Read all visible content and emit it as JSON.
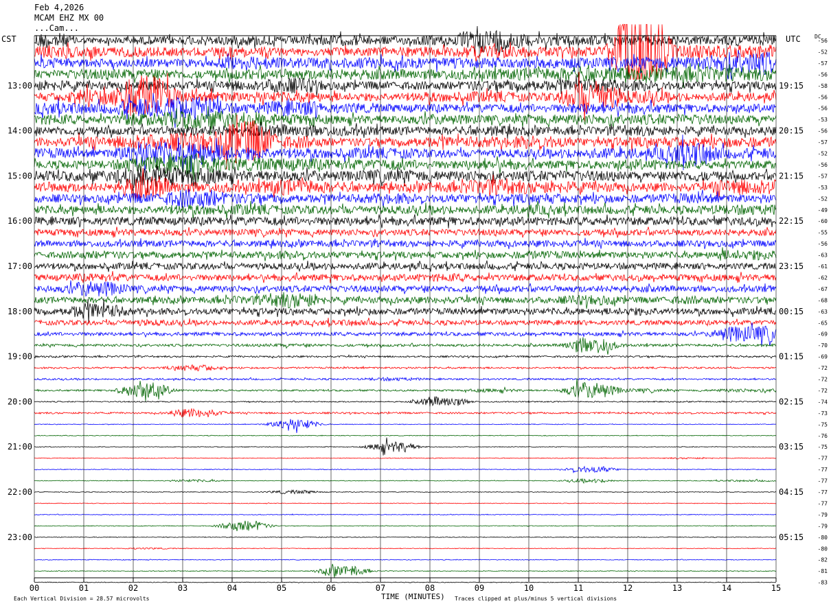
{
  "header": {
    "date": "Feb 4,2026",
    "station": "MCAM EHZ MX 00",
    "network_line": "...Cam..."
  },
  "labels": {
    "left_timezone": "CST",
    "right_timezone": "UTC",
    "dc_label": "DC"
  },
  "footer": {
    "scale_text": "Each Vertical Division =   28.57 microvolts",
    "xlabel": "TIME (MINUTES)",
    "clip_text": "Traces clipped at plus/minus 5 vertical divisions"
  },
  "colors": {
    "trace_cycle": [
      "#000000",
      "#ff0000",
      "#0000ff",
      "#006400"
    ],
    "grid": "#000000",
    "background": "#ffffff"
  },
  "chart_data": {
    "type": "line",
    "description_of_plot": "helicorder",
    "xlim": [
      0,
      15
    ],
    "x_ticks": [
      "00",
      "01",
      "02",
      "03",
      "04",
      "05",
      "06",
      "07",
      "08",
      "09",
      "10",
      "11",
      "12",
      "13",
      "14",
      "15"
    ],
    "left_time_labels": [
      "13:00",
      "14:00",
      "15:00",
      "16:00",
      "17:00",
      "18:00",
      "19:00",
      "20:00",
      "21:00",
      "22:00",
      "23:00"
    ],
    "right_time_labels": [
      "19:15",
      "20:15",
      "21:15",
      "22:15",
      "23:15",
      "00:15",
      "01:15",
      "02:15",
      "03:15",
      "04:15",
      "05:15"
    ],
    "left_label_first_trace_index": 4,
    "traces_per_hour": 4,
    "dc_offsets": [
      -56,
      -52,
      -57,
      -56,
      -58,
      -56,
      -56,
      -53,
      -56,
      -57,
      -52,
      -56,
      -57,
      -53,
      -52,
      -49,
      -60,
      -55,
      -56,
      -63,
      -61,
      -62,
      -67,
      -68,
      -63,
      -65,
      -69,
      -70,
      -69,
      -72,
      -72,
      -72,
      -74,
      -73,
      -75,
      -76,
      -75,
      -77,
      -77,
      -77,
      -77,
      -77,
      -79,
      -79,
      -80,
      -80,
      -82,
      -81,
      -83
    ],
    "trace_activity": [
      [
        1.6,
        1.2,
        1.3,
        1.3,
        1.4,
        1.3,
        1.4,
        1.3,
        1.4,
        1.8,
        1.4,
        1.4,
        1.4,
        1.3,
        1.4
      ],
      [
        1.5,
        1.4,
        1.4,
        1.3,
        1.4,
        1.3,
        1.3,
        1.4,
        1.4,
        1.5,
        1.4,
        1.4,
        3.0,
        1.5,
        1.5
      ],
      [
        1.4,
        1.3,
        1.3,
        1.3,
        1.5,
        1.4,
        1.4,
        1.4,
        1.4,
        1.4,
        1.4,
        1.4,
        1.5,
        1.5,
        1.8
      ],
      [
        1.3,
        1.4,
        1.4,
        1.3,
        1.4,
        1.4,
        1.4,
        1.4,
        1.4,
        1.4,
        1.5,
        1.6,
        1.5,
        1.6,
        1.5
      ],
      [
        1.4,
        1.3,
        1.3,
        1.3,
        1.4,
        1.6,
        1.3,
        1.3,
        1.3,
        1.4,
        1.4,
        1.5,
        1.4,
        1.3,
        1.3
      ],
      [
        1.3,
        1.6,
        2.2,
        1.4,
        1.4,
        1.4,
        1.3,
        1.3,
        1.4,
        1.4,
        1.3,
        2.0,
        1.5,
        1.3,
        1.3
      ],
      [
        1.5,
        1.4,
        1.7,
        1.8,
        1.4,
        1.6,
        1.4,
        1.3,
        1.3,
        1.3,
        1.3,
        1.4,
        1.4,
        1.3,
        1.3
      ],
      [
        1.4,
        1.3,
        1.5,
        1.7,
        1.6,
        1.4,
        1.3,
        1.3,
        1.4,
        1.3,
        1.4,
        1.4,
        1.4,
        1.4,
        1.3
      ],
      [
        1.3,
        1.3,
        1.3,
        1.4,
        1.4,
        1.5,
        1.4,
        1.3,
        1.3,
        1.4,
        1.3,
        1.3,
        1.4,
        1.3,
        1.3
      ],
      [
        1.3,
        1.4,
        1.6,
        1.7,
        2.2,
        1.5,
        1.3,
        1.3,
        1.4,
        1.4,
        1.5,
        1.3,
        1.4,
        1.4,
        1.4
      ],
      [
        1.4,
        1.3,
        1.8,
        1.8,
        1.5,
        1.4,
        1.4,
        1.4,
        1.3,
        1.3,
        1.3,
        1.4,
        1.4,
        1.8,
        1.4
      ],
      [
        1.3,
        1.3,
        1.6,
        1.8,
        1.5,
        1.5,
        1.4,
        1.4,
        1.3,
        1.4,
        1.3,
        1.3,
        1.4,
        1.3,
        1.3
      ],
      [
        1.4,
        1.4,
        1.8,
        1.6,
        1.4,
        1.4,
        1.4,
        1.5,
        1.4,
        1.4,
        1.4,
        1.4,
        1.3,
        1.4,
        1.3
      ],
      [
        1.4,
        1.3,
        1.8,
        1.4,
        1.4,
        1.6,
        1.4,
        1.3,
        1.4,
        1.6,
        1.5,
        1.4,
        1.3,
        1.3,
        1.6
      ],
      [
        1.3,
        1.3,
        1.4,
        1.7,
        1.4,
        1.3,
        1.3,
        1.4,
        1.3,
        1.3,
        1.4,
        1.3,
        1.3,
        1.4,
        1.3
      ],
      [
        1.3,
        1.3,
        1.3,
        1.4,
        1.4,
        1.3,
        1.3,
        1.3,
        1.3,
        1.3,
        1.4,
        1.3,
        1.3,
        1.3,
        1.4
      ],
      [
        1.3,
        1.3,
        1.3,
        1.3,
        1.3,
        1.3,
        1.3,
        1.3,
        1.3,
        1.3,
        1.3,
        1.3,
        1.3,
        1.3,
        1.3
      ],
      [
        1.2,
        1.2,
        1.2,
        1.2,
        1.2,
        1.2,
        1.2,
        1.2,
        1.2,
        1.2,
        1.2,
        1.2,
        1.2,
        1.2,
        1.2
      ],
      [
        1.2,
        1.2,
        1.2,
        1.2,
        1.2,
        1.2,
        1.2,
        1.2,
        1.2,
        1.2,
        1.2,
        1.2,
        1.2,
        1.2,
        1.2
      ],
      [
        1.2,
        1.3,
        1.2,
        1.2,
        1.2,
        1.3,
        1.2,
        1.2,
        1.2,
        1.2,
        1.3,
        1.2,
        1.2,
        1.2,
        1.4
      ],
      [
        1.2,
        1.2,
        1.2,
        1.2,
        1.2,
        1.2,
        1.2,
        1.2,
        1.2,
        1.2,
        1.2,
        1.2,
        1.2,
        1.2,
        1.2
      ],
      [
        1.2,
        1.3,
        1.2,
        1.2,
        1.2,
        1.2,
        1.2,
        1.2,
        1.3,
        1.2,
        1.2,
        1.2,
        1.2,
        1.2,
        1.2
      ],
      [
        1.2,
        1.6,
        1.2,
        1.2,
        1.2,
        1.2,
        1.2,
        1.2,
        1.2,
        1.2,
        1.2,
        1.2,
        1.2,
        1.2,
        1.2
      ],
      [
        1.2,
        1.2,
        1.2,
        1.2,
        1.3,
        1.6,
        1.2,
        1.2,
        1.2,
        1.2,
        1.2,
        1.4,
        1.2,
        1.3,
        1.2
      ],
      [
        1.2,
        1.6,
        1.2,
        1.2,
        1.2,
        1.2,
        1.2,
        1.2,
        1.2,
        1.2,
        1.2,
        1.2,
        1.3,
        1.2,
        1.2
      ],
      [
        1.1,
        1.1,
        1.2,
        1.1,
        1.1,
        1.1,
        1.2,
        1.1,
        1.1,
        1.1,
        1.1,
        1.1,
        1.1,
        1.1,
        1.1
      ],
      [
        1.0,
        1.0,
        1.0,
        1.0,
        1.0,
        1.0,
        1.0,
        1.0,
        1.0,
        1.0,
        1.0,
        1.0,
        1.0,
        1.0,
        1.6
      ],
      [
        0.9,
        0.9,
        0.9,
        0.9,
        0.9,
        1.0,
        0.9,
        0.9,
        0.9,
        0.9,
        0.9,
        1.6,
        0.9,
        0.9,
        0.9
      ],
      [
        0.8,
        0.8,
        0.8,
        0.8,
        0.8,
        0.8,
        0.8,
        0.8,
        0.8,
        0.8,
        0.8,
        0.8,
        0.8,
        0.8,
        0.8
      ],
      [
        0.8,
        0.8,
        0.8,
        1.2,
        0.8,
        0.8,
        0.8,
        0.8,
        0.8,
        0.8,
        0.8,
        0.8,
        0.8,
        0.8,
        0.8
      ],
      [
        0.8,
        0.8,
        0.8,
        0.8,
        0.8,
        0.8,
        0.8,
        1.0,
        0.8,
        0.8,
        0.8,
        0.8,
        0.8,
        0.8,
        0.8
      ],
      [
        0.8,
        0.8,
        1.6,
        0.8,
        0.8,
        0.8,
        0.8,
        0.8,
        0.8,
        1.0,
        0.8,
        1.6,
        1.0,
        0.8,
        1.0
      ],
      [
        0.7,
        0.7,
        0.7,
        0.7,
        0.7,
        0.7,
        0.7,
        0.7,
        1.4,
        0.7,
        0.7,
        0.7,
        0.7,
        0.7,
        0.7
      ],
      [
        0.8,
        0.8,
        0.8,
        1.3,
        0.8,
        0.8,
        0.8,
        0.8,
        0.8,
        0.8,
        0.8,
        0.8,
        0.8,
        0.8,
        0.8
      ],
      [
        0.6,
        0.6,
        0.6,
        0.6,
        0.6,
        1.4,
        0.6,
        0.6,
        0.6,
        0.6,
        0.6,
        0.6,
        0.6,
        0.6,
        0.6
      ],
      [
        0.6,
        0.6,
        0.6,
        0.6,
        0.6,
        0.6,
        0.6,
        0.6,
        0.6,
        0.6,
        0.6,
        0.6,
        0.6,
        0.6,
        0.6
      ],
      [
        0.6,
        0.6,
        0.6,
        0.6,
        0.6,
        0.6,
        0.6,
        1.4,
        0.6,
        0.6,
        0.6,
        0.6,
        0.6,
        0.6,
        0.6
      ],
      [
        0.6,
        0.6,
        0.6,
        0.6,
        0.6,
        0.6,
        0.6,
        0.6,
        0.6,
        0.6,
        0.6,
        0.6,
        0.6,
        0.8,
        0.6
      ],
      [
        0.6,
        0.6,
        0.6,
        0.6,
        0.6,
        0.6,
        0.6,
        0.6,
        0.6,
        0.6,
        0.6,
        1.2,
        0.6,
        0.6,
        0.6
      ],
      [
        0.6,
        0.6,
        0.6,
        0.9,
        0.6,
        0.6,
        0.6,
        0.6,
        0.6,
        0.6,
        0.6,
        1.0,
        0.6,
        0.6,
        0.8
      ],
      [
        0.6,
        0.6,
        0.6,
        0.6,
        0.6,
        1.0,
        0.6,
        0.6,
        0.6,
        0.6,
        0.6,
        0.6,
        0.6,
        0.6,
        0.6
      ],
      [
        0.6,
        0.6,
        0.6,
        0.6,
        0.6,
        0.6,
        0.6,
        0.6,
        0.6,
        0.6,
        0.6,
        0.6,
        0.6,
        0.6,
        0.6
      ],
      [
        0.6,
        0.6,
        0.6,
        0.6,
        0.6,
        0.6,
        0.6,
        0.6,
        0.6,
        0.6,
        0.6,
        0.6,
        0.6,
        0.6,
        0.6
      ],
      [
        0.6,
        0.6,
        0.6,
        0.6,
        1.4,
        0.6,
        0.6,
        0.6,
        0.6,
        0.6,
        0.6,
        0.6,
        0.6,
        0.6,
        0.6
      ],
      [
        0.6,
        0.6,
        0.6,
        0.6,
        0.6,
        0.6,
        0.6,
        0.6,
        0.6,
        0.6,
        0.6,
        0.6,
        0.6,
        0.6,
        0.6
      ],
      [
        0.6,
        0.6,
        0.8,
        0.6,
        0.6,
        0.6,
        0.6,
        0.6,
        0.6,
        0.6,
        0.6,
        0.6,
        0.6,
        0.6,
        0.6
      ],
      [
        0.6,
        0.6,
        0.6,
        0.6,
        0.6,
        0.6,
        0.6,
        0.6,
        0.6,
        0.6,
        0.6,
        0.6,
        0.6,
        0.6,
        0.6
      ],
      [
        0.6,
        0.6,
        0.6,
        0.6,
        0.6,
        0.6,
        1.4,
        0.6,
        0.6,
        0.6,
        0.6,
        0.6,
        0.6,
        0.6,
        0.6
      ],
      [
        0.6,
        0.6,
        0.6,
        0.6,
        0.6,
        0.6,
        0.6,
        0.6,
        0.6,
        0.6,
        0.6,
        0.6,
        0.6,
        0.6,
        0.6
      ]
    ]
  }
}
